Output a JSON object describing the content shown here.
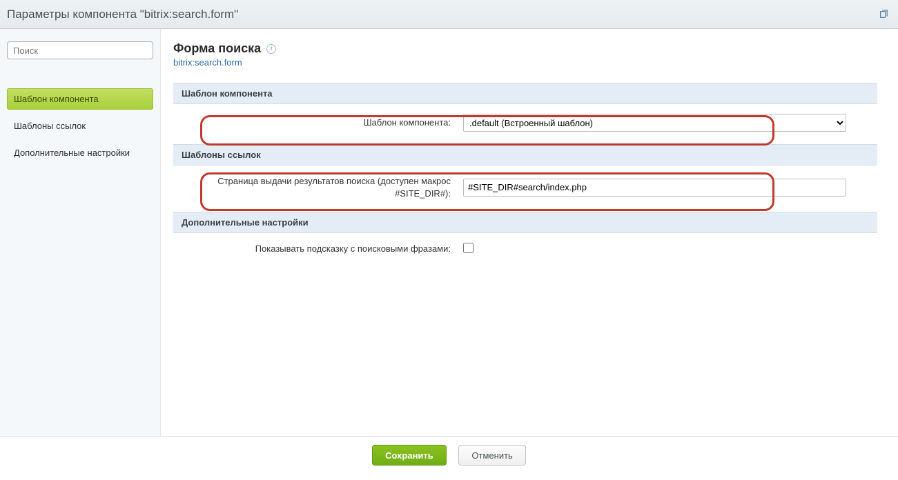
{
  "window": {
    "title": "Параметры компонента \"bitrix:search.form\""
  },
  "sidebar": {
    "search_placeholder": "Поиск",
    "items": [
      {
        "label": "Шаблон компонента",
        "active": true
      },
      {
        "label": "Шаблоны ссылок",
        "active": false
      },
      {
        "label": "Дополнительные настройки",
        "active": false
      }
    ]
  },
  "page": {
    "title": "Форма поиска",
    "component_code": "bitrix:search.form"
  },
  "sections": {
    "template": {
      "heading": "Шаблон компонента",
      "field_label": "Шаблон компонента:",
      "field_value": ".default (Встроенный шаблон)"
    },
    "link_templates": {
      "heading": "Шаблоны ссылок",
      "field_label": "Страница выдачи результатов поиска (доступен макрос #SITE_DIR#):",
      "field_value": "#SITE_DIR#search/index.php"
    },
    "extra": {
      "heading": "Дополнительные настройки",
      "field_label": "Показывать подсказку с поисковыми фразами:",
      "checked": false
    }
  },
  "footer": {
    "save": "Сохранить",
    "cancel": "Отменить"
  }
}
